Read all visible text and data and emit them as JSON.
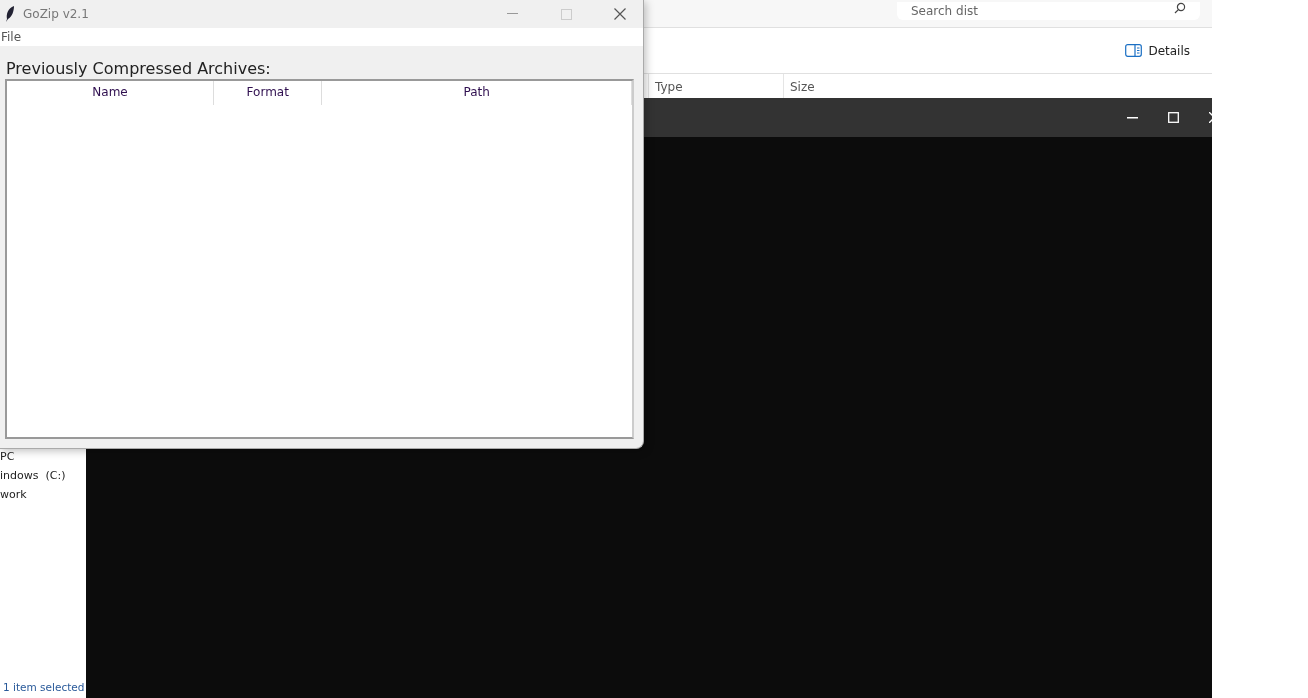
{
  "explorer": {
    "search": {
      "placeholder": "Search dist"
    },
    "toolbar": [
      "Details"
    ],
    "columns": [
      "Type",
      "Size"
    ],
    "sidebar": [
      "PC",
      "indows  (C:)",
      "work"
    ],
    "status": "1 item selected"
  },
  "gozip": {
    "title": "GoZip v2.1",
    "menu": [
      "File"
    ],
    "heading": "Previously Compressed Archives:",
    "columns": [
      "Name",
      "Format",
      "Path"
    ]
  }
}
